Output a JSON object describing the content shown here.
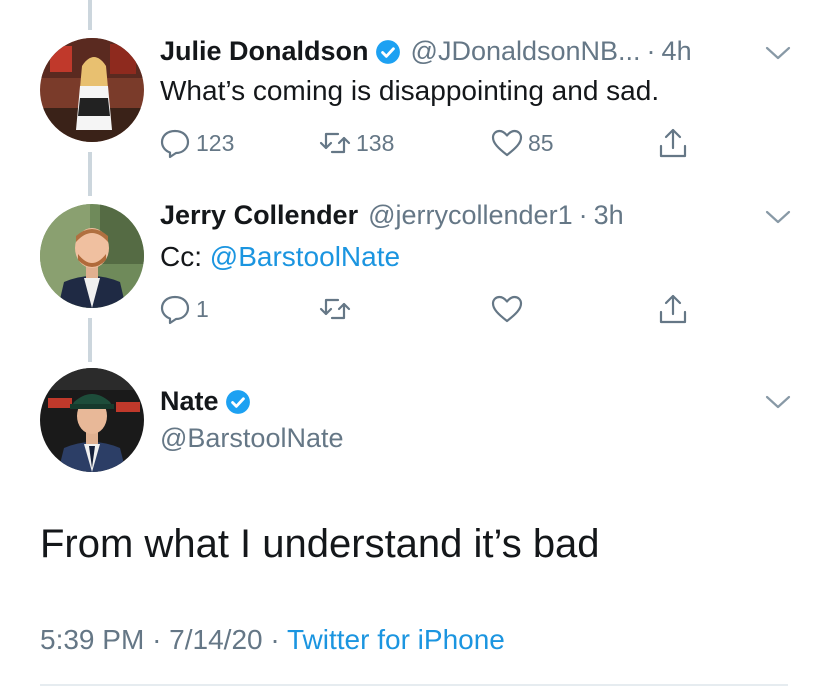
{
  "colors": {
    "link": "#1b95e0",
    "secondary_text": "#657786",
    "verified_badge": "#1da1f2",
    "thread_line": "#ccd6dd"
  },
  "tweets": [
    {
      "name": "Julie Donaldson",
      "verified": true,
      "handle": "@JDonaldsonNB...",
      "separator": "·",
      "time": "4h",
      "text": "What’s coming is disappointing and sad.",
      "reply_count": "123",
      "retweet_count": "138",
      "like_count": "85",
      "icons": [
        "reply-icon",
        "retweet-icon",
        "like-icon",
        "share-icon",
        "chevron-down-icon"
      ]
    },
    {
      "name": "Jerry Collender",
      "verified": false,
      "handle": "@jerrycollender1",
      "separator": "·",
      "time": "3h",
      "text_prefix": "Cc: ",
      "mention": "@BarstoolNate",
      "reply_count": "1",
      "retweet_count": "",
      "like_count": "",
      "icons": [
        "reply-icon",
        "retweet-icon",
        "like-icon",
        "share-icon",
        "chevron-down-icon"
      ]
    }
  ],
  "main_tweet": {
    "name": "Nate",
    "verified": true,
    "handle": "@BarstoolNate",
    "text": "From what I understand it’s bad",
    "time": "5:39 PM",
    "separator1": "·",
    "date": "7/14/20",
    "separator2": "·",
    "source": "Twitter for iPhone"
  }
}
